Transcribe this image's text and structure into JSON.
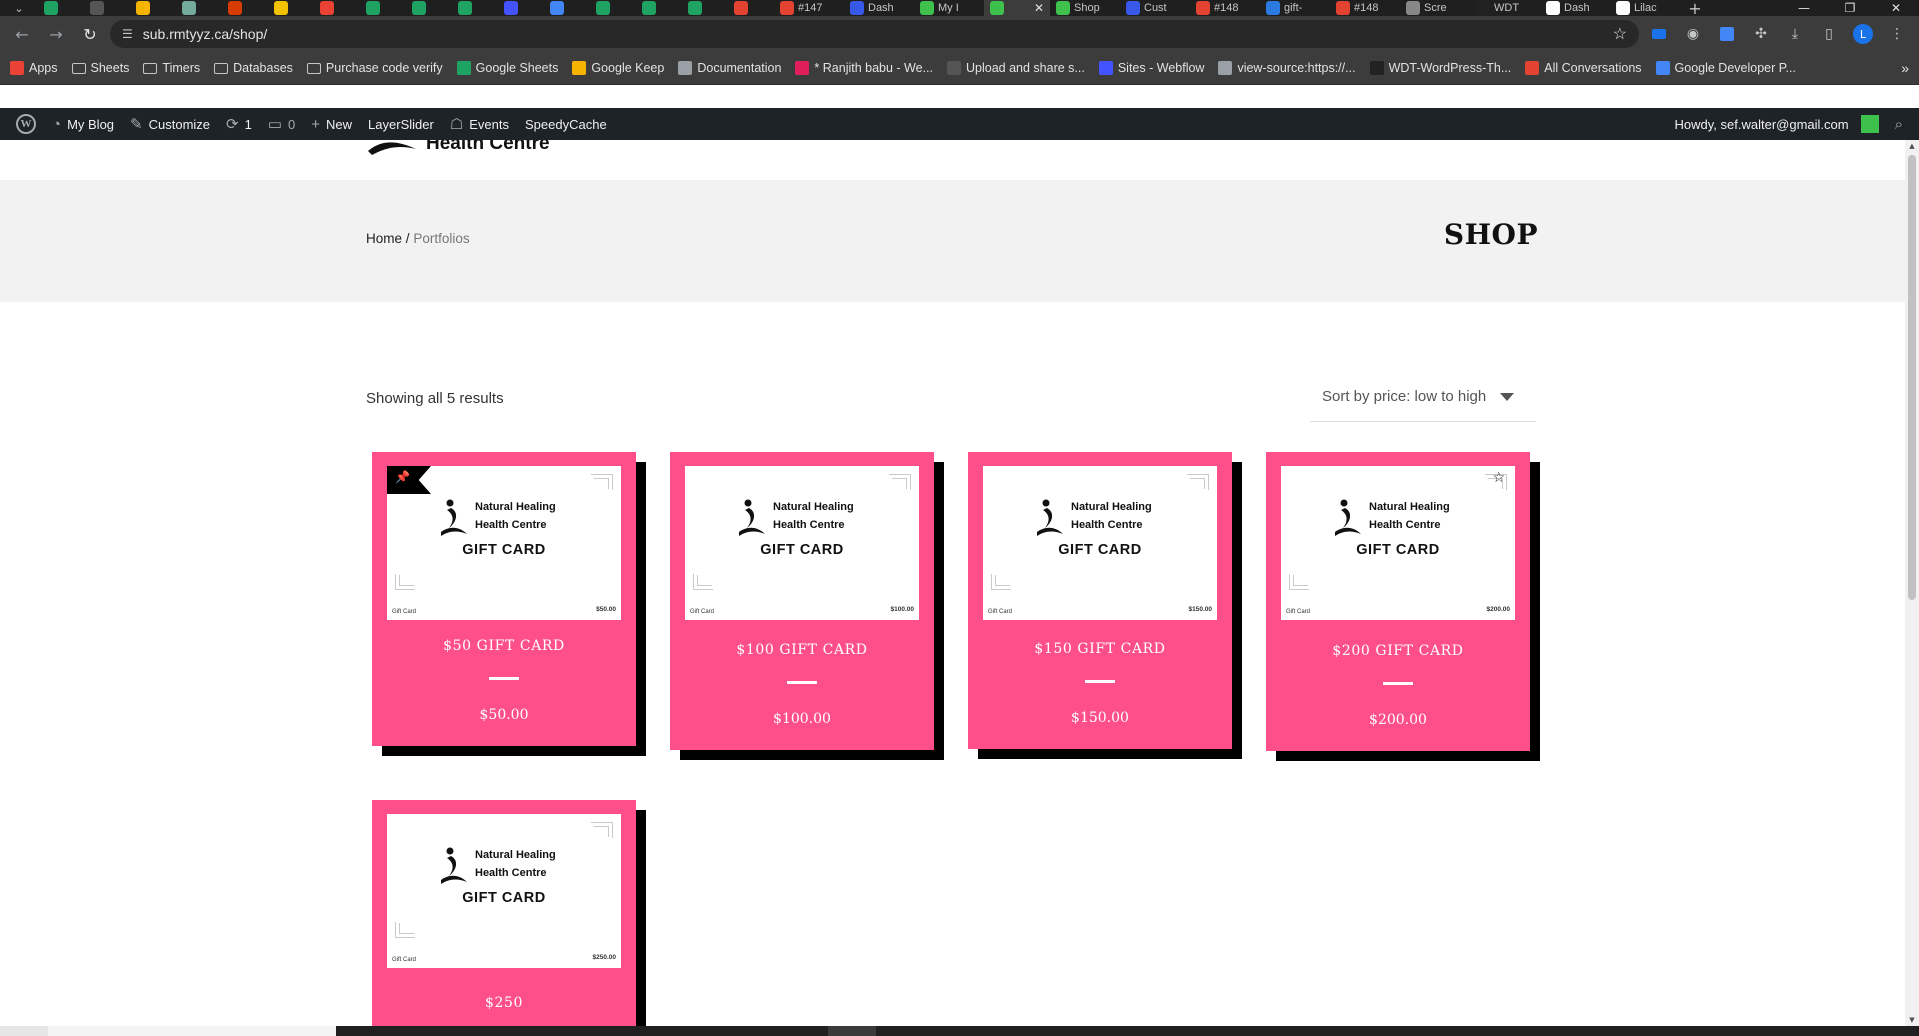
{
  "browser": {
    "tabs": [
      {
        "label": "",
        "favicon": "sheets-icon",
        "color": "#1ea362"
      },
      {
        "label": "",
        "favicon": "sb-icon",
        "color": "#555555"
      },
      {
        "label": "",
        "favicon": "keep-icon",
        "color": "#f5b400"
      },
      {
        "label": "",
        "favicon": "chatgpt-icon",
        "color": "#74aa9c"
      },
      {
        "label": "",
        "favicon": "office-icon",
        "color": "#d83b01"
      },
      {
        "label": "",
        "favicon": "clockify-icon",
        "color": "#f2c200"
      },
      {
        "label": "",
        "favicon": "gmail-icon",
        "color": "#ea4335"
      },
      {
        "label": "",
        "favicon": "sheets-icon",
        "color": "#1ea362"
      },
      {
        "label": "",
        "favicon": "sheets-icon",
        "color": "#1ea362"
      },
      {
        "label": "",
        "favicon": "sheets-icon",
        "color": "#1ea362"
      },
      {
        "label": "",
        "favicon": "webflow-icon",
        "color": "#4353ff"
      },
      {
        "label": "",
        "favicon": "google-icon",
        "color": "#4285f4"
      },
      {
        "label": "",
        "favicon": "sheets-icon",
        "color": "#1ea362"
      },
      {
        "label": "",
        "favicon": "sheets-icon",
        "color": "#1ea362"
      },
      {
        "label": "",
        "favicon": "sheets-icon",
        "color": "#1ea362"
      },
      {
        "label": "",
        "favicon": "todoist-icon",
        "color": "#e44332"
      },
      {
        "label": "#147",
        "favicon": "todoist-icon",
        "color": "#e44332"
      },
      {
        "label": "Dash",
        "favicon": "wordpress-icon",
        "color": "#3858e9"
      },
      {
        "label": "My I",
        "favicon": "blog-icon",
        "color": "#3ec14c"
      },
      {
        "label": "",
        "favicon": "blog-icon",
        "color": "#3ec14c",
        "active": true
      },
      {
        "label": "Shop",
        "favicon": "blog-icon",
        "color": "#3ec14c"
      },
      {
        "label": "Cust",
        "favicon": "wordpress-icon",
        "color": "#3858e9"
      },
      {
        "label": "#148",
        "favicon": "todoist-icon",
        "color": "#e44332"
      },
      {
        "label": "gift-",
        "favicon": "ibb-icon",
        "color": "#2a7ae2"
      },
      {
        "label": "#148",
        "favicon": "todoist-icon",
        "color": "#e44332"
      },
      {
        "label": "Scre",
        "favicon": "globe-icon",
        "color": "#888888"
      },
      {
        "label": "WDT",
        "favicon": "github-icon",
        "color": "#222222"
      },
      {
        "label": "Dash",
        "favicon": "lilac-icon",
        "color": "#ffffff"
      },
      {
        "label": "Lilac",
        "favicon": "lilac-icon",
        "color": "#ffffff"
      }
    ],
    "url": "sub.rmtyyz.ca/shop/",
    "profile_initial": "L",
    "bookmarks": [
      {
        "label": "Apps",
        "icon": "apps-grid-icon",
        "color": "#ea4335"
      },
      {
        "label": "Sheets",
        "icon": "folder-icon"
      },
      {
        "label": "Timers",
        "icon": "folder-icon"
      },
      {
        "label": "Databases",
        "icon": "folder-icon"
      },
      {
        "label": "Purchase code verify",
        "icon": "folder-icon"
      },
      {
        "label": "Google Sheets",
        "icon": "sheets-icon",
        "color": "#1ea362"
      },
      {
        "label": "Google Keep",
        "icon": "keep-icon",
        "color": "#f5b400"
      },
      {
        "label": "Documentation",
        "icon": "globe-icon",
        "color": "#9aa0a6"
      },
      {
        "label": "* Ranjith babu - We...",
        "icon": "slack-icon",
        "color": "#e01e5a"
      },
      {
        "label": "Upload and share s...",
        "icon": "sb-icon",
        "color": "#555555"
      },
      {
        "label": "Sites - Webflow",
        "icon": "webflow-icon",
        "color": "#4353ff"
      },
      {
        "label": "view-source:https://...",
        "icon": "globe-icon",
        "color": "#9aa0a6"
      },
      {
        "label": "WDT-WordPress-Th...",
        "icon": "github-icon",
        "color": "#222222"
      },
      {
        "label": "All Conversations",
        "icon": "todoist-icon",
        "color": "#e44332"
      },
      {
        "label": "Google Developer P...",
        "icon": "google-icon",
        "color": "#4285f4"
      }
    ]
  },
  "adminbar": {
    "site": "My Blog",
    "customize": "Customize",
    "updates": "1",
    "comments": "0",
    "new": "New",
    "layerslider": "LayerSlider",
    "events": "Events",
    "speedycache": "SpeedyCache",
    "howdy": "Howdy, sef.walter@gmail.com"
  },
  "site": {
    "logo_text": "Health Centre"
  },
  "page_header": {
    "breadcrumb_home": "Home",
    "breadcrumb_sep": "/",
    "breadcrumb_current": "Portfolios",
    "title": "SHOP"
  },
  "shop": {
    "result_count": "Showing all 5 results",
    "sort_selected": "Sort by price: low to high",
    "accent": "#ff4f8b",
    "gift_card_brand_line1": "Natural Healing",
    "gift_card_brand_line2": "Health Centre",
    "gift_card_title": "GIFT CARD",
    "gift_card_footer": "Gift Card",
    "products": [
      {
        "name": "$50 GIFT CARD",
        "price": "$50.00",
        "card_amount": "$50.00",
        "badge": "pin-icon"
      },
      {
        "name": "$100 GIFT CARD",
        "price": "$100.00",
        "card_amount": "$100.00",
        "badge": ""
      },
      {
        "name": "$150 GIFT CARD",
        "price": "$150.00",
        "card_amount": "$150.00",
        "badge": ""
      },
      {
        "name": "$200 GIFT CARD",
        "price": "$200.00",
        "card_amount": "$200.00",
        "badge": "star-icon"
      },
      {
        "name": "$250",
        "price": "",
        "card_amount": "$250.00",
        "badge": ""
      }
    ]
  }
}
